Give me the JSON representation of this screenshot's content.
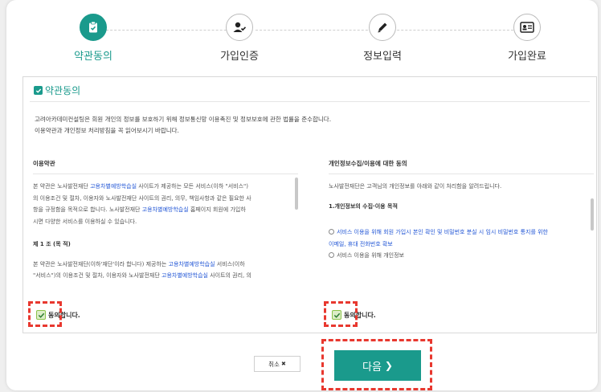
{
  "steps": [
    {
      "label": "약관동의",
      "icon": "clipboard-check-icon",
      "active": true
    },
    {
      "label": "가입인증",
      "icon": "user-check-icon",
      "active": false
    },
    {
      "label": "정보입력",
      "icon": "pencil-icon",
      "active": false
    },
    {
      "label": "가입완료",
      "icon": "id-card-icon",
      "active": false
    }
  ],
  "panel": {
    "title": "약관동의",
    "intro_line1": "고려아카데미컨설팅은 회원 개인의 정보를 보호하기 위해 정보통신망 이용촉진 및 정보보호에 관한 법률을 준수합니다.",
    "intro_line2": "이용약관과 개인정보 처리방침을 꼭 읽어보시기 바랍니다."
  },
  "terms": {
    "heading": "이용약관",
    "p1_a": "본 약관은 노사발전재단 ",
    "p1_link": "고용차별예방학습실",
    "p1_b": " 사이트가 제공하는 모든 서비스(이하 \"서비스\")",
    "p1_line2": "의 이용조건 및 절차, 이용자와 노사발전재단 사이트의 권리, 의무, 책임사항과 같은 필요한 사",
    "p1_line3_a": "항을 규정함을 목적으로 합니다. 노사발전재단 ",
    "p1_line3_link": "고용차별예방학습실",
    "p1_line3_b": " 홈페이지 회원에 가입하",
    "p1_line4": "시면 다양한 서비스를 이용하실 수 있습니다.",
    "article": "제 1 조 (목 적)",
    "p2_a": "본 약관은 노사발전재단(이하'재단'이라 합니다) 제공하는 ",
    "p2_link": "고용차별예방학습실",
    "p2_b": " 서비스(이하",
    "p2_line2_a": "\"서비스\")의 이용조건 및 절차, 이용자와 노사발전재단 ",
    "p2_line2_link": "고용차별예방학습실",
    "p2_line2_b": " 사이트의 권리, 의",
    "agree_label": "동의합니다."
  },
  "privacy": {
    "heading": "개인정보수집/이용에 대한 동의",
    "p1": "노사발전재단은 고객님의 개인정보를 아래와 같이 처리함을 알려드립니다.",
    "sub": "1.개인정보의 수집·이용 목적",
    "opt1_line1": "서비스 이용을 위해 회원 가입시 본인 확인 및 비밀번호 분실 시 임시 비밀번호 통지를 위한",
    "opt1_line2": "이메일, 휴대 전화번호 확보",
    "opt2": "서비스 이용을 위해 개인정보",
    "agree_label": "동의합니다."
  },
  "buttons": {
    "cancel": "취소",
    "cancel_mark": "✖",
    "next": "다음",
    "next_mark": "❯"
  },
  "colors": {
    "accent": "#1a9a8c",
    "link": "#2357d6",
    "highlight": "#e8382f"
  }
}
